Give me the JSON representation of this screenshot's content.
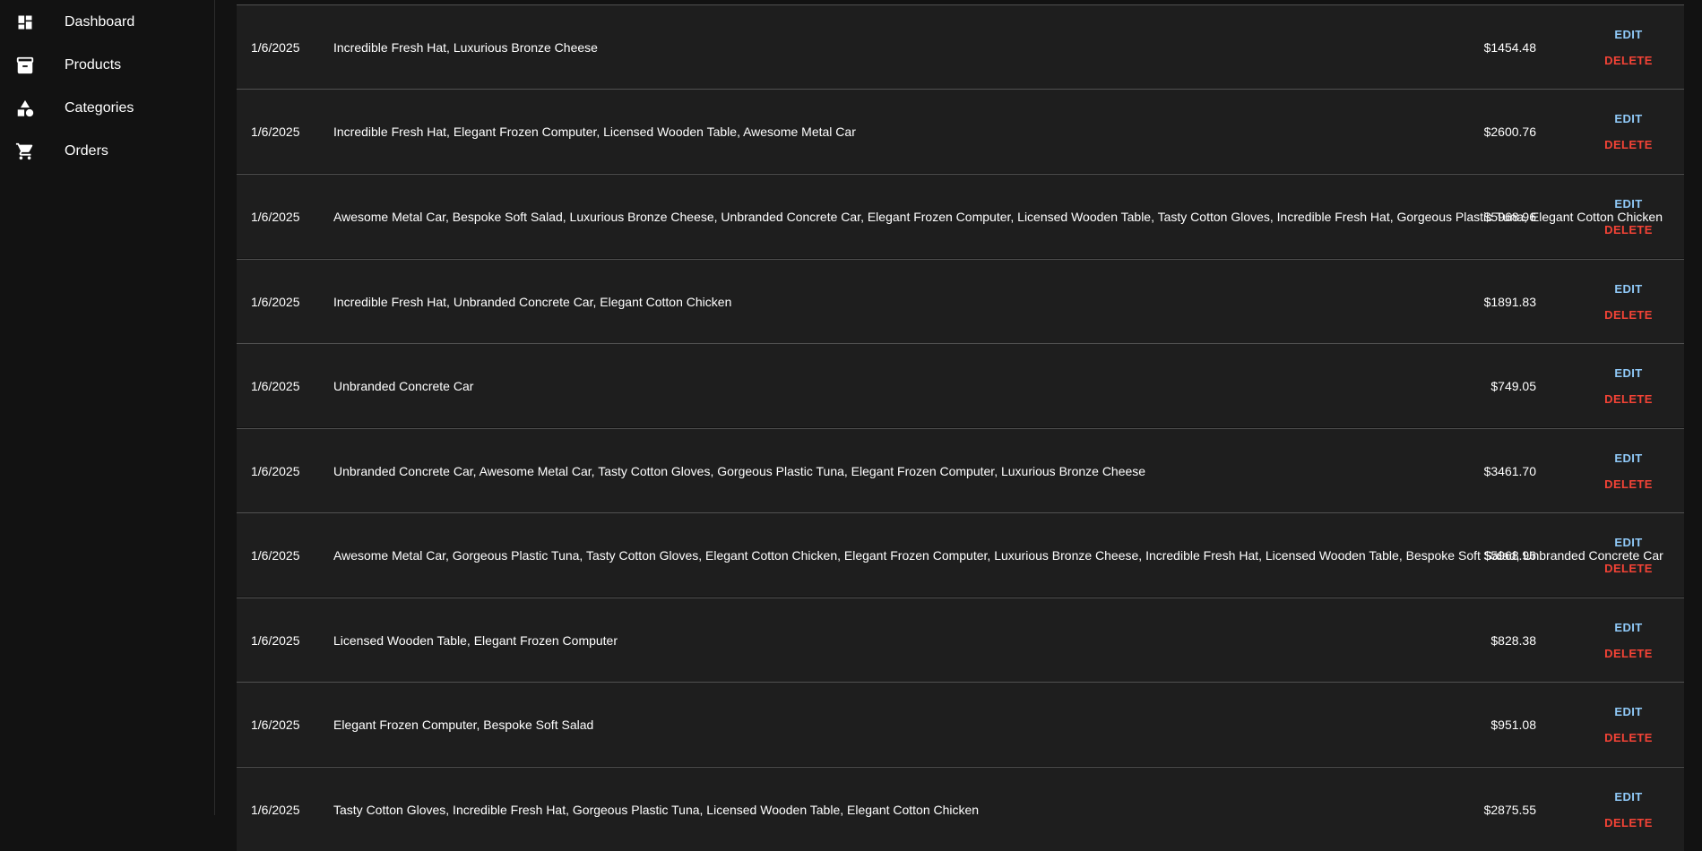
{
  "sidebar": {
    "items": [
      {
        "label": "Dashboard",
        "icon": "dashboard-icon"
      },
      {
        "label": "Products",
        "icon": "archive-icon"
      },
      {
        "label": "Categories",
        "icon": "category-icon"
      },
      {
        "label": "Orders",
        "icon": "cart-icon"
      }
    ]
  },
  "actions": {
    "edit": "EDIT",
    "delete": "DELETE"
  },
  "colors": {
    "edit": "#90caf9",
    "delete": "#f44336",
    "row_bg": "#1e1e1e",
    "page_bg": "#121212"
  },
  "orders": [
    {
      "date": "1/6/2025",
      "items": "Incredible Fresh Hat, Luxurious Bronze Cheese",
      "total": "$1454.48"
    },
    {
      "date": "1/6/2025",
      "items": "Incredible Fresh Hat, Elegant Frozen Computer, Licensed Wooden Table, Awesome Metal Car",
      "total": "$2600.76"
    },
    {
      "date": "1/6/2025",
      "items": "Awesome Metal Car, Bespoke Soft Salad, Luxurious Bronze Cheese, Unbranded Concrete Car, Elegant Frozen Computer, Licensed Wooden Table, Tasty Cotton Gloves, Incredible Fresh Hat, Gorgeous Plastic Tuna, Elegant Cotton Chicken",
      "total": "$5968.96"
    },
    {
      "date": "1/6/2025",
      "items": "Incredible Fresh Hat, Unbranded Concrete Car, Elegant Cotton Chicken",
      "total": "$1891.83"
    },
    {
      "date": "1/6/2025",
      "items": "Unbranded Concrete Car",
      "total": "$749.05"
    },
    {
      "date": "1/6/2025",
      "items": "Unbranded Concrete Car, Awesome Metal Car, Tasty Cotton Gloves, Gorgeous Plastic Tuna, Elegant Frozen Computer, Luxurious Bronze Cheese",
      "total": "$3461.70"
    },
    {
      "date": "1/6/2025",
      "items": "Awesome Metal Car, Gorgeous Plastic Tuna, Tasty Cotton Gloves, Elegant Cotton Chicken, Elegant Frozen Computer, Luxurious Bronze Cheese, Incredible Fresh Hat, Licensed Wooden Table, Bespoke Soft Salad, Unbranded Concrete Car",
      "total": "$5968.96"
    },
    {
      "date": "1/6/2025",
      "items": "Licensed Wooden Table, Elegant Frozen Computer",
      "total": "$828.38"
    },
    {
      "date": "1/6/2025",
      "items": "Elegant Frozen Computer, Bespoke Soft Salad",
      "total": "$951.08"
    },
    {
      "date": "1/6/2025",
      "items": "Tasty Cotton Gloves, Incredible Fresh Hat, Gorgeous Plastic Tuna, Licensed Wooden Table, Elegant Cotton Chicken",
      "total": "$2875.55"
    }
  ]
}
